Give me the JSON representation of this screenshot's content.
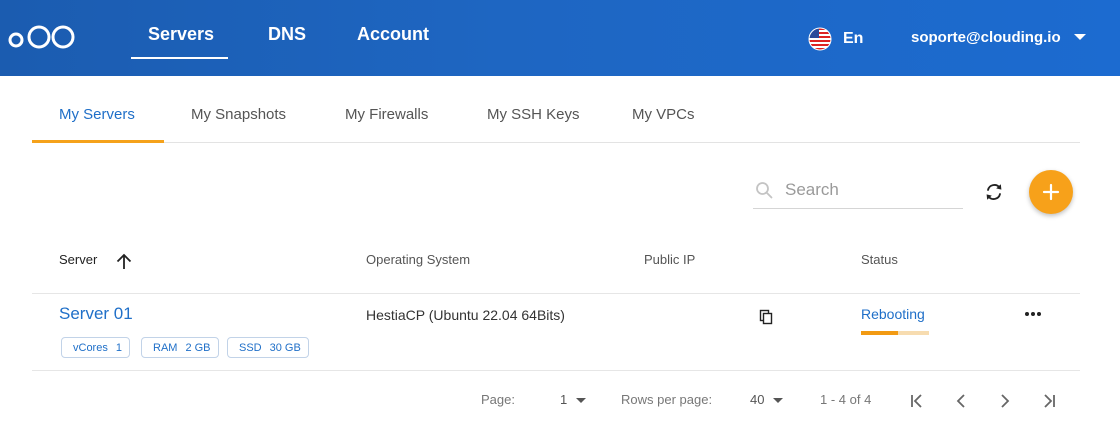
{
  "header": {
    "brand": "Clouding",
    "nav": [
      "Servers",
      "DNS",
      "Account"
    ],
    "active_nav": "Servers",
    "language": "En",
    "language_flag": "us-flag-icon",
    "user_email": "soporte@clouding.io",
    "colors": {
      "bar": "#1e66c2",
      "text": "#ffffff"
    }
  },
  "tabs": {
    "items": [
      "My Servers",
      "My Snapshots",
      "My Firewalls",
      "My SSH Keys",
      "My VPCs"
    ],
    "active": "My Servers",
    "accent": "#f5a21b"
  },
  "toolbar": {
    "search_placeholder": "Search",
    "search_value": "",
    "refresh_icon": "refresh-icon",
    "add_icon": "plus-icon",
    "add_color": "#f7a11a"
  },
  "table": {
    "columns": {
      "server": "Server",
      "os": "Operating System",
      "ip": "Public IP",
      "status": "Status"
    },
    "sort": {
      "column": "Server",
      "direction": "ascending"
    },
    "rows": [
      {
        "name": "Server 01",
        "specs": [
          {
            "label": "vCores",
            "value": "1"
          },
          {
            "label": "RAM",
            "value": "2 GB"
          },
          {
            "label": "SSD",
            "value": "30 GB"
          }
        ],
        "os": "HestiaCP (Ubuntu 22.04 64Bits)",
        "public_ip": "",
        "status": "Rebooting",
        "status_progress": 0.55
      }
    ]
  },
  "pagination": {
    "page_label": "Page:",
    "page": "1",
    "rows_label": "Rows per page:",
    "rows_per_page": "40",
    "range": "1 - 4 of 4"
  }
}
